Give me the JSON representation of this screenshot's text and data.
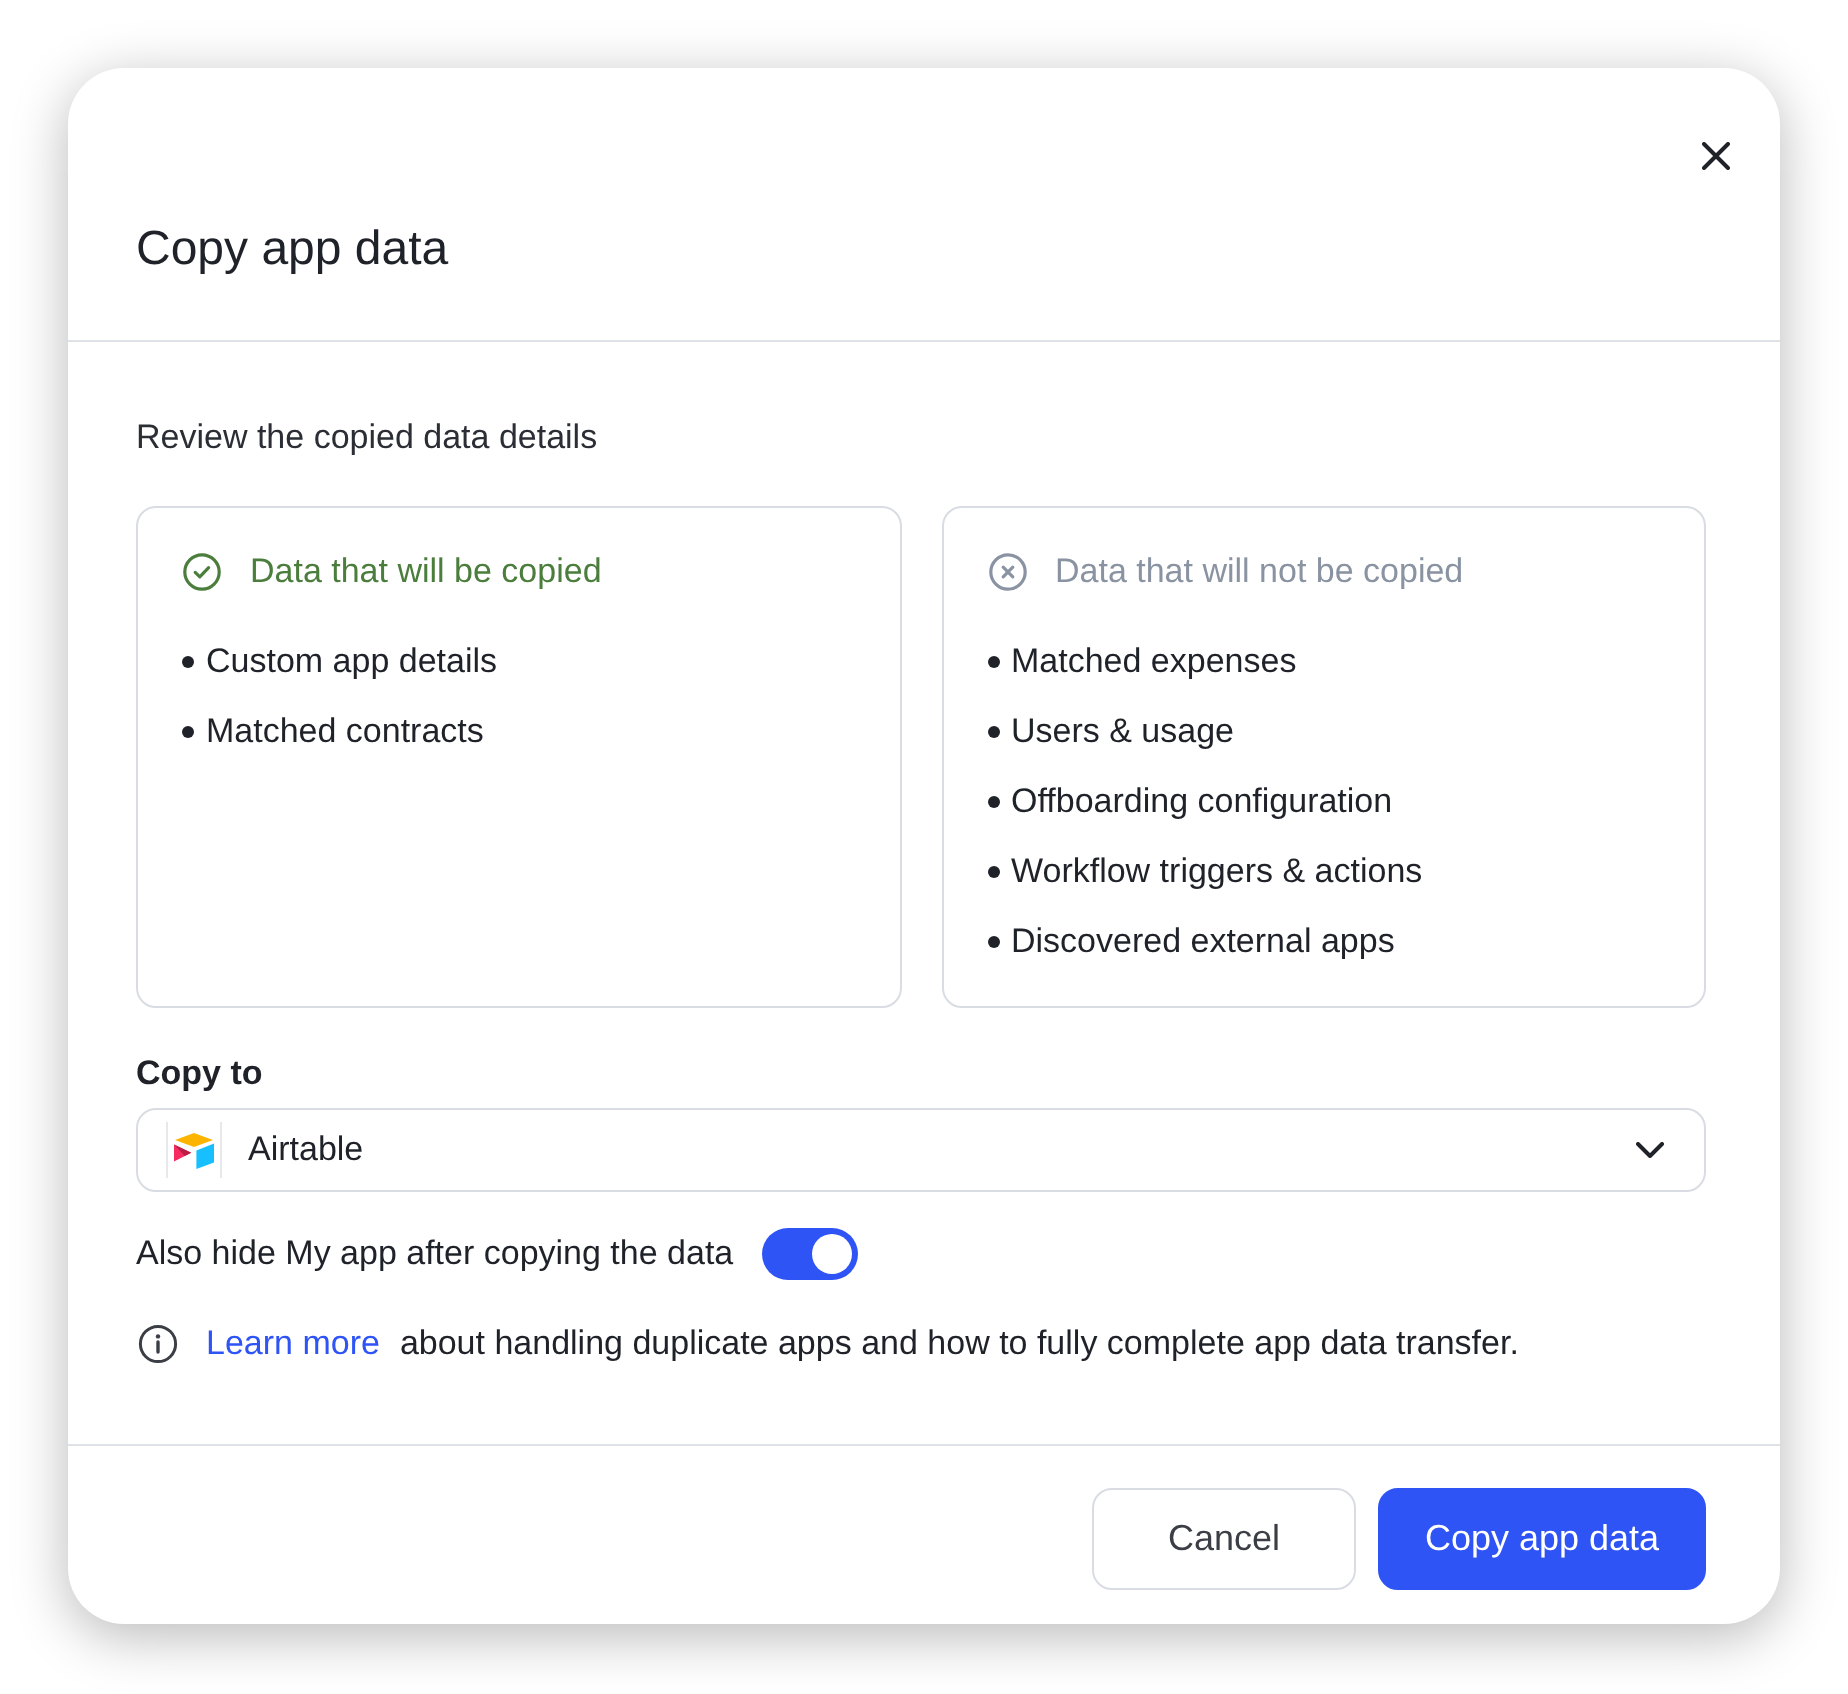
{
  "dialog": {
    "title": "Copy app data",
    "intro": "Review the copied data details",
    "panels": [
      {
        "kind": "included",
        "heading": "Data that will be copied",
        "items": [
          "Custom app details",
          "Matched contracts"
        ]
      },
      {
        "kind": "excluded",
        "heading": "Data that will not be copied",
        "items": [
          "Matched expenses",
          "Users & usage",
          "Offboarding configuration",
          "Workflow triggers & actions",
          "Discovered external apps"
        ]
      }
    ],
    "copy_to": {
      "label": "Copy to",
      "value": "Airtable"
    },
    "hide_toggle": {
      "label": "Also hide My app after copying the data",
      "on": true
    },
    "info": {
      "link": "Learn more",
      "text": "about handling duplicate apps and how to fully complete app data transfer."
    },
    "buttons": [
      {
        "kind": "secondary",
        "label": "Cancel"
      },
      {
        "kind": "primary",
        "label": "Copy app data"
      }
    ]
  }
}
